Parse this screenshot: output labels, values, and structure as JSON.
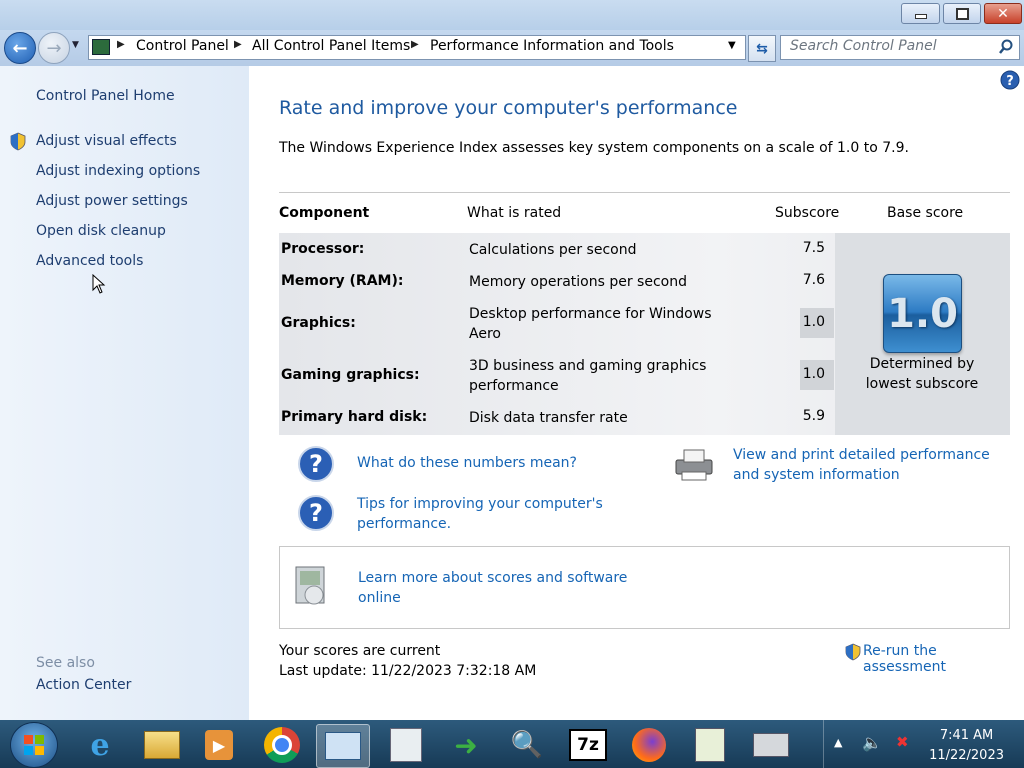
{
  "window": {
    "title": ""
  },
  "address": {
    "crumbs": [
      "Control Panel",
      "All Control Panel Items",
      "Performance Information and Tools"
    ],
    "search_placeholder": "Search Control Panel"
  },
  "sidebar": {
    "home": "Control Panel Home",
    "items": [
      {
        "label": "Adjust visual effects",
        "shield": true
      },
      {
        "label": "Adjust indexing options",
        "shield": false
      },
      {
        "label": "Adjust power settings",
        "shield": false
      },
      {
        "label": "Open disk cleanup",
        "shield": false
      },
      {
        "label": "Advanced tools",
        "shield": false
      }
    ],
    "see_also": "See also",
    "action_center": "Action Center"
  },
  "main": {
    "title": "Rate and improve your computer's performance",
    "intro": "The Windows Experience Index assesses key system components on a scale of 1.0 to 7.9.",
    "table": {
      "headers": {
        "component": "Component",
        "what": "What is rated",
        "subscore": "Subscore",
        "base": "Base score"
      },
      "rows": [
        {
          "component": "Processor:",
          "what": "Calculations per second",
          "subscore": "7.5"
        },
        {
          "component": "Memory (RAM):",
          "what": "Memory operations per second",
          "subscore": "7.6"
        },
        {
          "component": "Graphics:",
          "what": "Desktop performance for Windows Aero",
          "subscore": "1.0"
        },
        {
          "component": "Gaming graphics:",
          "what": "3D business and gaming graphics performance",
          "subscore": "1.0"
        },
        {
          "component": "Primary hard disk:",
          "what": "Disk data transfer rate",
          "subscore": "5.9"
        }
      ],
      "base_score": "1.0",
      "base_caption": "Determined by lowest subscore"
    },
    "links": {
      "numbers_mean": "What do these numbers mean?",
      "tips": "Tips for improving your computer's performance.",
      "view_print": "View and print detailed performance and system information",
      "learn_more": "Learn more about scores and software online",
      "rerun": "Re-run the assessment"
    },
    "status": {
      "current": "Your scores are current",
      "last_update": "Last update: 11/22/2023 7:32:18 AM"
    }
  },
  "taskbar": {
    "time": "7:41 AM",
    "date": "11/22/2023",
    "apps": [
      "start-orb",
      "internet-explorer-icon",
      "explorer-folder-icon",
      "media-player-icon",
      "chrome-icon",
      "control-panel-icon",
      "task-manager-icon",
      "download-manager-icon",
      "search-icon",
      "7zip-icon",
      "firefox-icon",
      "notepad-icon",
      "fax-scan-icon"
    ]
  },
  "colors": {
    "link": "#1665b5",
    "title": "#1f5aa0",
    "sidebar_bg": "#e6eef8",
    "taskbar": "#1f4566"
  }
}
